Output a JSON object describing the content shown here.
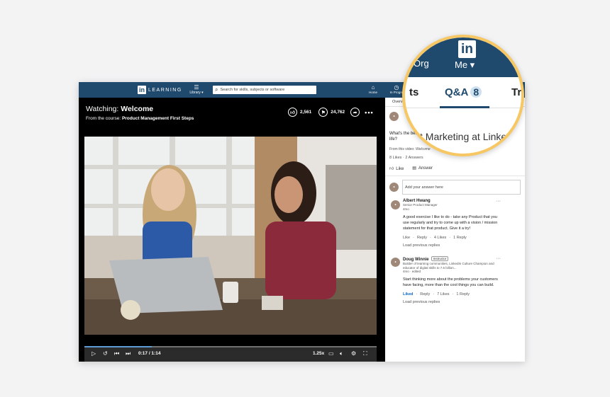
{
  "nav": {
    "logo_text": "LEARNING",
    "library_label": "Library ▾",
    "search_placeholder": "Search for skills, subjects or software",
    "home_label": "Home",
    "in_progress_label": "In Progre"
  },
  "player": {
    "watching_prefix": "Watching: ",
    "watching_title": "Welcome",
    "course_prefix": "From the course: ",
    "course_title": "Product Management First Steps",
    "likes_count": "2,561",
    "saves_count": "24,762",
    "time": "0:17 / 1:14",
    "speed": "1.25x",
    "progress_fraction": 0.23
  },
  "panel": {
    "tab_overview": "Overvi",
    "question": "What's the best Product Marketing at LinkedIn life?",
    "question_visible": "What's the bes",
    "question_line2": "life?",
    "from_video_prefix": "From this video: ",
    "from_video_title": "Welcome",
    "stats": "8 Likes · 2 Answers",
    "like_label": "Like",
    "answer_label": "Answer",
    "answer_placeholder": "Add your answer here",
    "replies": [
      {
        "name": "Albert Hwang",
        "title": "Senior Product Manager",
        "time": "4mo",
        "text": "A good exercise I like to do - take any Product that you use regularly and try to come up with a vision / mission statement for that product. Give it a try!",
        "like": "Like",
        "reply": "Reply",
        "likes": "4 Likes",
        "replies": "1 Reply",
        "load": "Load previous replies"
      },
      {
        "name": "Doug Winnie",
        "badge": "Instructor",
        "title": "Builder of learning communities, LinkedIn Culture Champion and educator of digital skills to 7.6 billion...",
        "time": "4mo · edited",
        "text": "Start thinking more about the problems your customers have facing, more than the cool things you can build.",
        "like": "Liked",
        "reply": "Reply",
        "likes": "7 Likes",
        "replies": "1 Reply",
        "load": "Load previous replies"
      }
    ]
  },
  "magnifier": {
    "org_label": "Org",
    "me_label": "Me ▾",
    "tab_left": "ts",
    "tab_qa": "Q&A",
    "qa_count": "8",
    "tab_right": "Tr",
    "question_fragment": "ct Marketing at Linke"
  },
  "colors": {
    "nav_bg": "#1f4a6e",
    "accent": "#5d9bd6",
    "magnifier_ring": "#f6c763"
  }
}
